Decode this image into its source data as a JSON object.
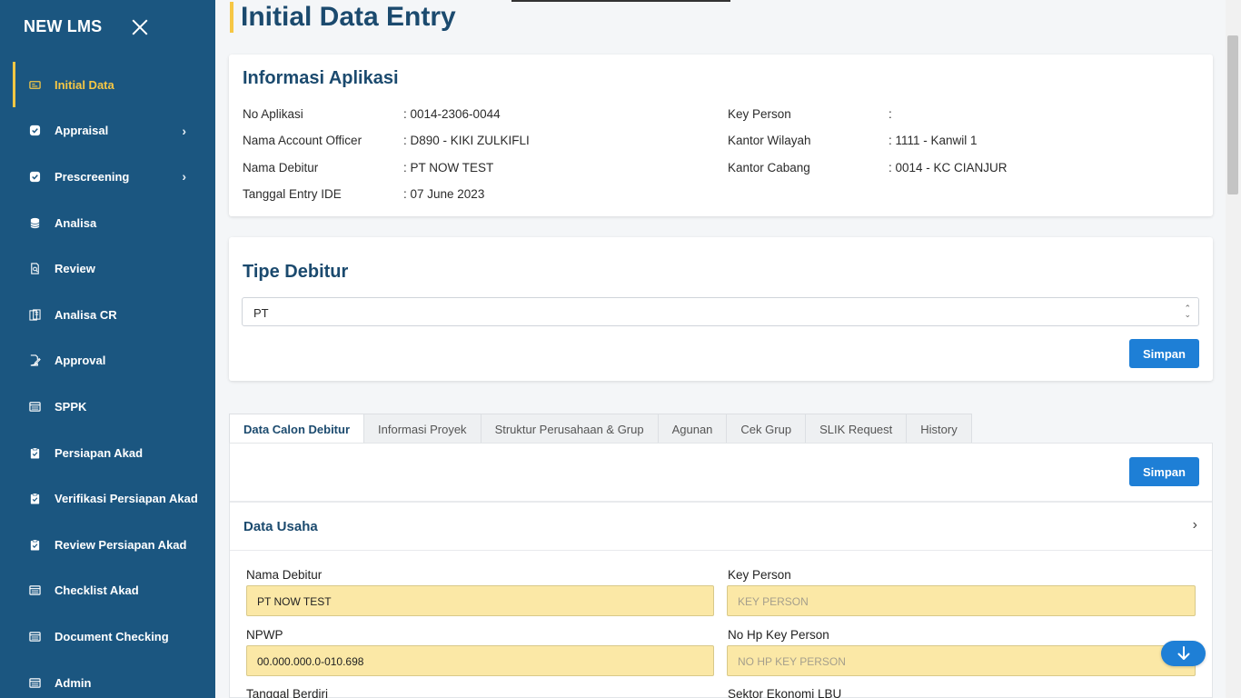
{
  "app": {
    "brand": "NEW LMS"
  },
  "sidebar": {
    "items": [
      {
        "label": "Initial Data",
        "icon": "id-card-icon",
        "active": true,
        "chevron": false
      },
      {
        "label": "Appraisal",
        "icon": "check-badge-icon",
        "active": false,
        "chevron": true
      },
      {
        "label": "Prescreening",
        "icon": "check-badge-icon",
        "active": false,
        "chevron": true
      },
      {
        "label": "Analisa",
        "icon": "database-icon",
        "active": false,
        "chevron": false
      },
      {
        "label": "Review",
        "icon": "file-search-icon",
        "active": false,
        "chevron": false
      },
      {
        "label": "Analisa CR",
        "icon": "documents-icon",
        "active": false,
        "chevron": false
      },
      {
        "label": "Approval",
        "icon": "file-sign-icon",
        "active": false,
        "chevron": false
      },
      {
        "label": "SPPK",
        "icon": "list-icon",
        "active": false,
        "chevron": false
      },
      {
        "label": "Persiapan Akad",
        "icon": "clipboard-icon",
        "active": false,
        "chevron": false
      },
      {
        "label": "Verifikasi Persiapan Akad",
        "icon": "clipboard-icon",
        "active": false,
        "chevron": false
      },
      {
        "label": "Review Persiapan Akad",
        "icon": "clipboard-icon",
        "active": false,
        "chevron": false
      },
      {
        "label": "Checklist Akad",
        "icon": "list-icon",
        "active": false,
        "chevron": false
      },
      {
        "label": "Document Checking",
        "icon": "list-icon",
        "active": false,
        "chevron": false
      },
      {
        "label": "Admin",
        "icon": "list-icon",
        "active": false,
        "chevron": false
      }
    ]
  },
  "page": {
    "title": "Initial Data Entry"
  },
  "info": {
    "title": "Informasi Aplikasi",
    "left": [
      {
        "label": "No Aplikasi",
        "value": ": 0014-2306-0044"
      },
      {
        "label": "Nama Account Officer",
        "value": ": D890 - KIKI ZULKIFLI"
      },
      {
        "label": "Nama Debitur",
        "value": ": PT NOW TEST"
      },
      {
        "label": "Tanggal Entry IDE",
        "value": ": 07 June 2023"
      }
    ],
    "right": [
      {
        "label": "Key Person",
        "value": ":"
      },
      {
        "label": "Kantor Wilayah",
        "value": ": 1111 - Kanwil 1"
      },
      {
        "label": "Kantor Cabang",
        "value": ": 0014 - KC CIANJUR"
      }
    ]
  },
  "tipe": {
    "title": "Tipe Debitur",
    "selected": "PT",
    "save_label": "Simpan"
  },
  "tabs": [
    {
      "label": "Data Calon Debitur",
      "active": true
    },
    {
      "label": "Informasi Proyek",
      "active": false
    },
    {
      "label": "Struktur Perusahaan & Grup",
      "active": false
    },
    {
      "label": "Agunan",
      "active": false
    },
    {
      "label": "Cek Grup",
      "active": false
    },
    {
      "label": "SLIK Request",
      "active": false
    },
    {
      "label": "History",
      "active": false
    }
  ],
  "panel": {
    "save_label": "Simpan",
    "section_title": "Data Usaha",
    "fields": {
      "nama_debitur": {
        "label": "Nama Debitur",
        "value": "PT NOW TEST"
      },
      "key_person": {
        "label": "Key Person",
        "placeholder": "KEY PERSON"
      },
      "npwp": {
        "label": "NPWP",
        "value": "00.000.000.0-010.698"
      },
      "no_hp": {
        "label": "No Hp Key Person",
        "placeholder": "NO HP KEY PERSON"
      },
      "tanggal_berdiri": {
        "label": "Tanggal Berdiri"
      },
      "sektor": {
        "label": "Sektor Ekonomi LBU"
      }
    }
  },
  "colors": {
    "sidebar": "#1b5680",
    "accent": "#f6c744",
    "primary": "#1e7fd6",
    "heading": "#1b4a6e",
    "input_bg": "#fbe8a6"
  }
}
